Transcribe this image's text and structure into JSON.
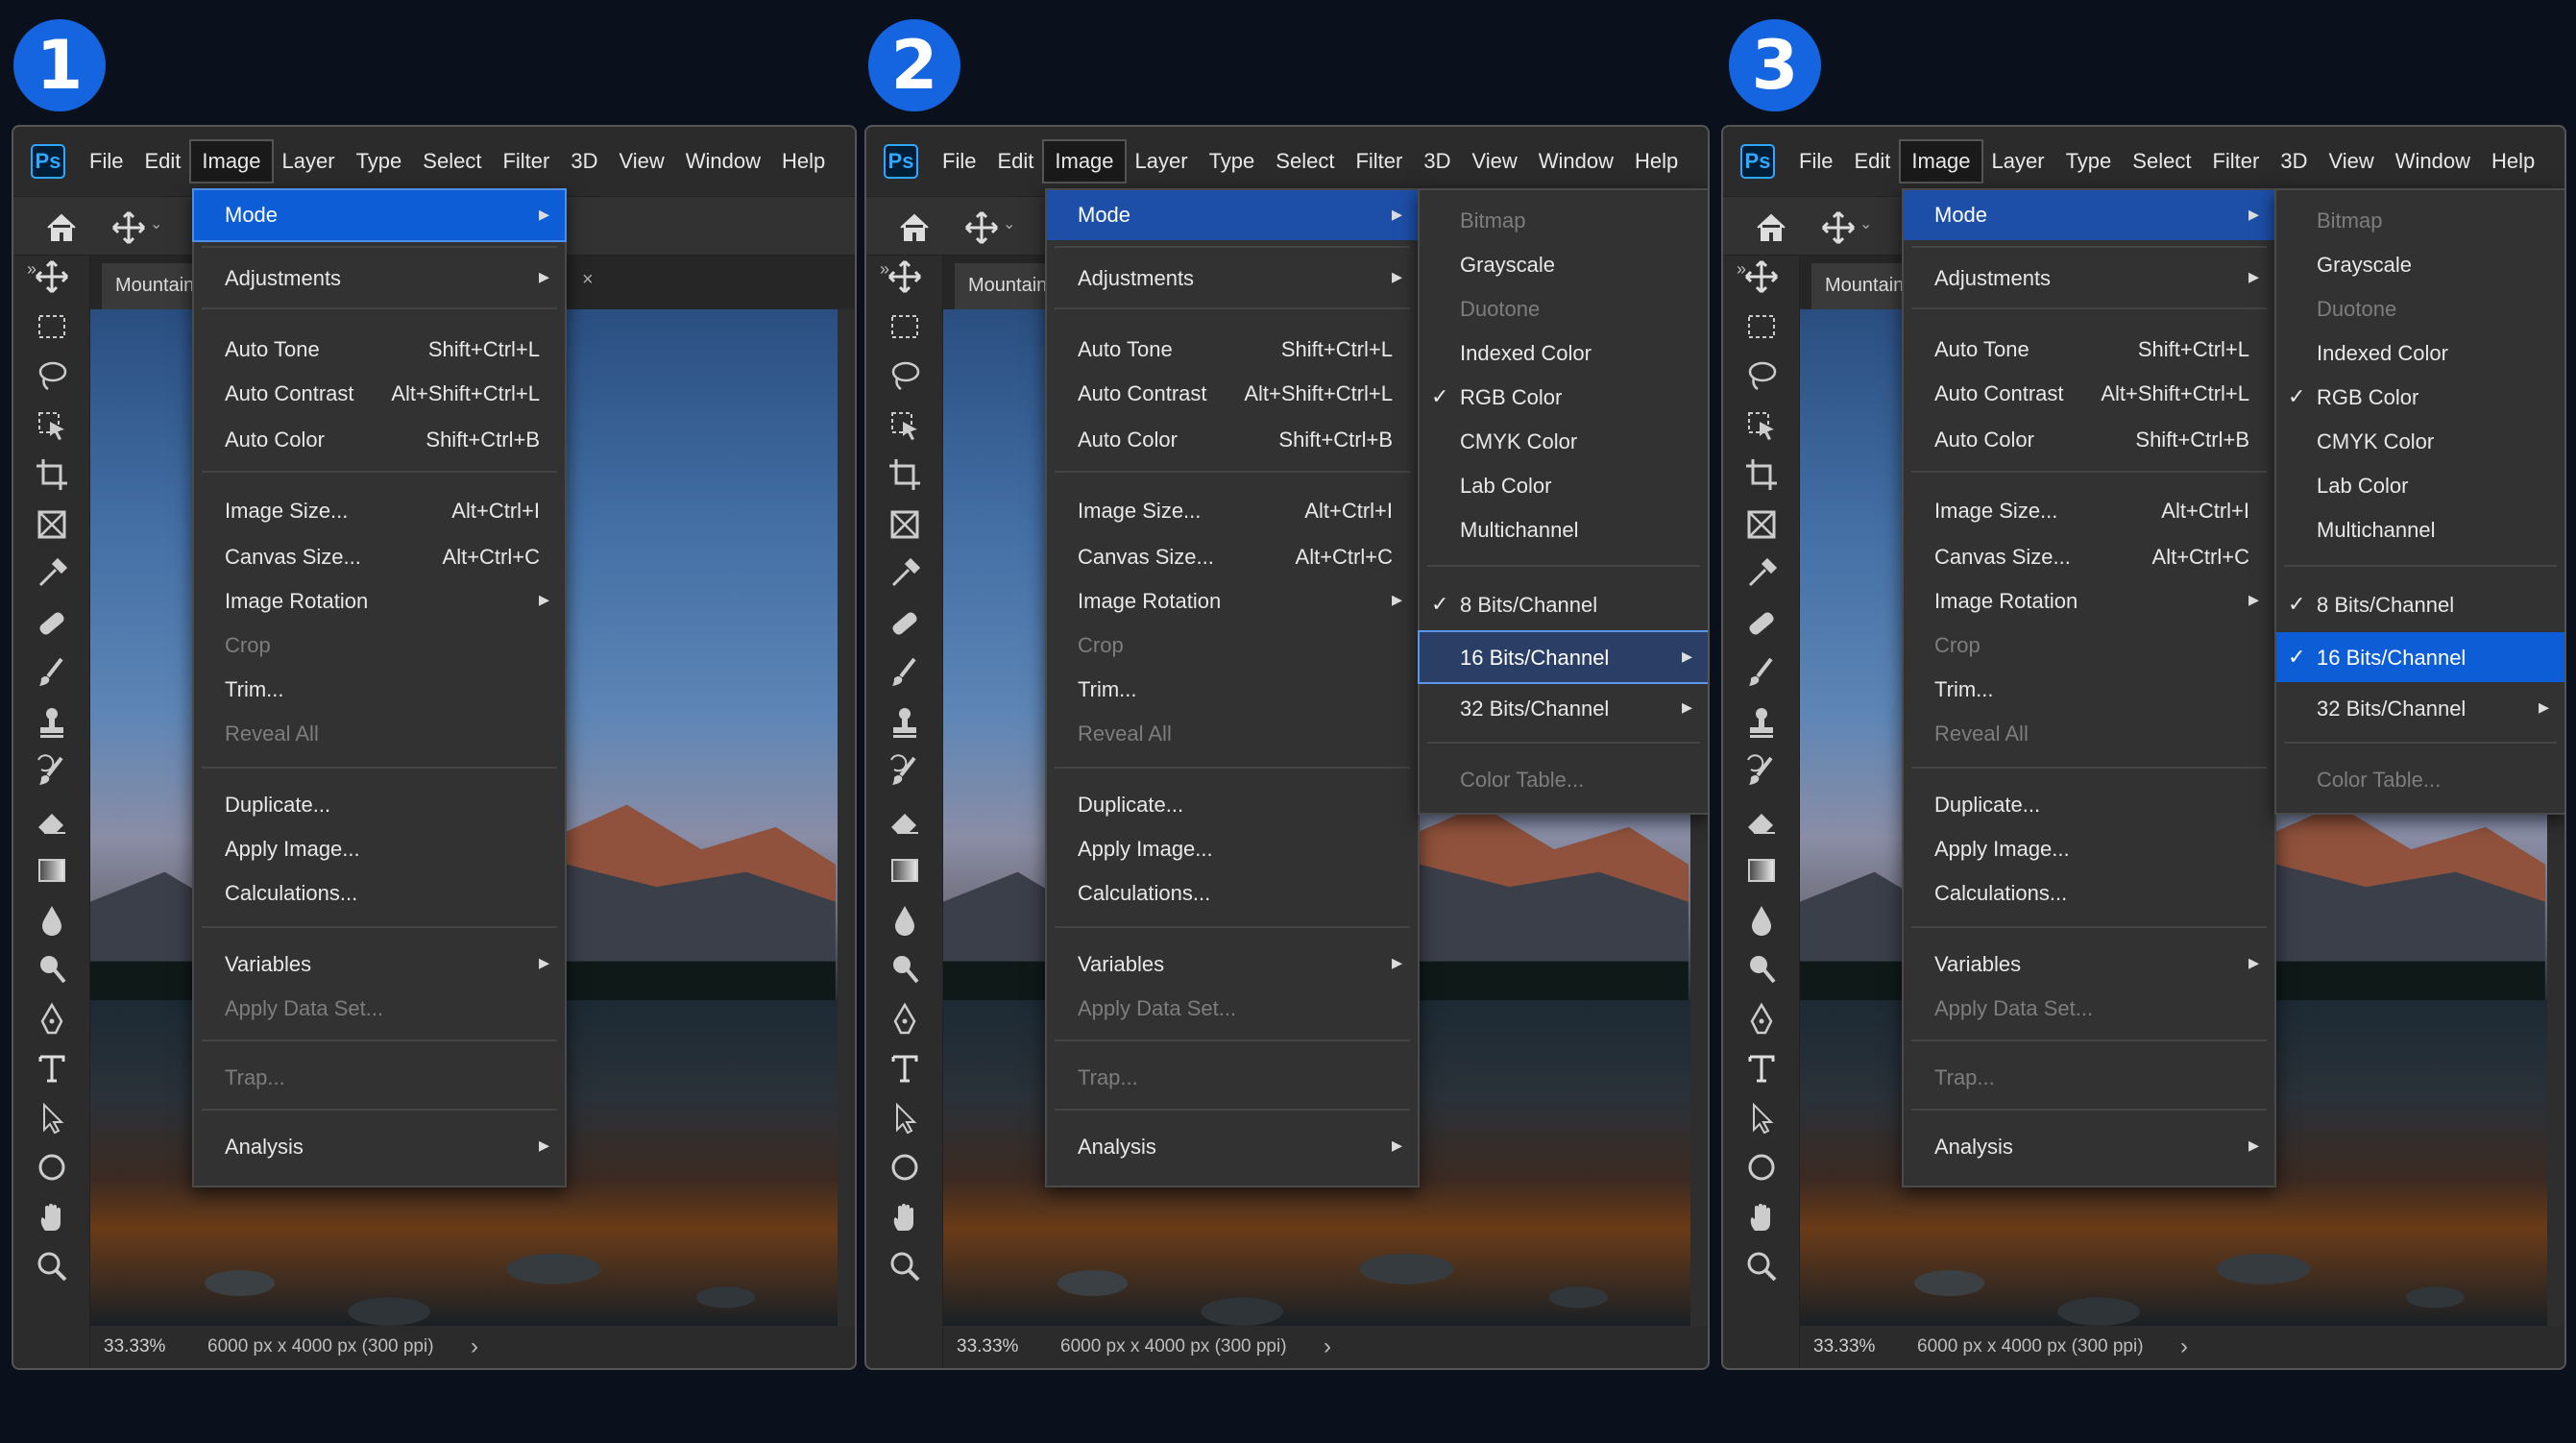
{
  "step_badges": [
    "1",
    "2",
    "3"
  ],
  "app_logo": "Ps",
  "menubar": [
    "File",
    "Edit",
    "Image",
    "Layer",
    "Type",
    "Select",
    "Filter",
    "3D",
    "View",
    "Window",
    "Help"
  ],
  "active_menu": "Image",
  "document_tab": "Mountain",
  "status": {
    "zoom": "33.33%",
    "size": "6000 px x 4000 px (300 ppi)"
  },
  "image_menu": {
    "mode": "Mode",
    "adjustments": "Adjustments",
    "auto_tone": {
      "label": "Auto Tone",
      "shortcut": "Shift+Ctrl+L"
    },
    "auto_contrast": {
      "label": "Auto Contrast",
      "shortcut": "Alt+Shift+Ctrl+L"
    },
    "auto_color": {
      "label": "Auto Color",
      "shortcut": "Shift+Ctrl+B"
    },
    "image_size": {
      "label": "Image Size...",
      "shortcut": "Alt+Ctrl+I"
    },
    "canvas_size": {
      "label": "Canvas Size...",
      "shortcut": "Alt+Ctrl+C"
    },
    "image_rotation": "Image Rotation",
    "crop": "Crop",
    "trim": "Trim...",
    "reveal_all": "Reveal All",
    "duplicate": "Duplicate...",
    "apply_image": "Apply Image...",
    "calculations": "Calculations...",
    "variables": "Variables",
    "apply_data_set": "Apply Data Set...",
    "trap": "Trap...",
    "analysis": "Analysis"
  },
  "mode_submenu": {
    "bitmap": "Bitmap",
    "grayscale": "Grayscale",
    "duotone": "Duotone",
    "indexed_color": "Indexed Color",
    "rgb_color": "RGB Color",
    "cmyk_color": "CMYK Color",
    "lab_color": "Lab Color",
    "multichannel": "Multichannel",
    "bits8": "8 Bits/Channel",
    "bits16": "16 Bits/Channel",
    "bits32": "32 Bits/Channel",
    "color_table": "Color Table..."
  },
  "colors": {
    "accent": "#0d5ed6",
    "badge": "#1565e0",
    "menu_bg": "#323232",
    "disabled": "#7d7d7d"
  }
}
